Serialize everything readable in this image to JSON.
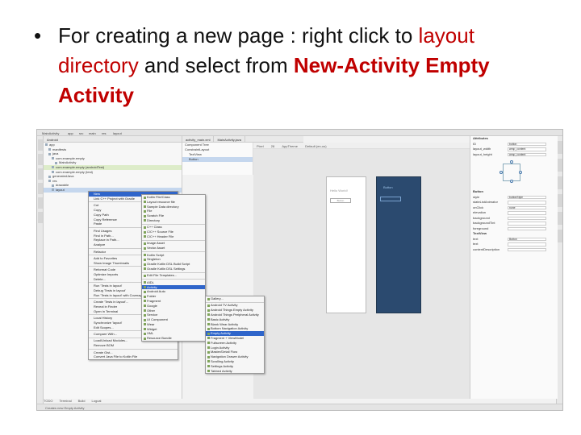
{
  "slide": {
    "bullet": "•",
    "line1_a": "For creating a new page : right click to ",
    "line1_b": "layout",
    "line2_a": "directory",
    "line2_b": " and select from ",
    "line2_c": "New-Activity Empty",
    "line3": "Activity"
  },
  "ide": {
    "titlebar": [
      "MainActivity",
      "app",
      "src",
      "main",
      "res",
      "layout"
    ],
    "project_header": "Android",
    "tree": [
      "app",
      "manifests",
      "java",
      "com.example.empty",
      "MainActivity",
      "com.example.empty (androidTest)",
      "com.example.empty (test)",
      "generatedJava",
      "res",
      "drawable",
      "layout"
    ],
    "editor_tabs": [
      "activity_main.xml",
      "MainActivity.java"
    ],
    "palette": [
      "Component Tree",
      "ConstraintLayout",
      "TextView",
      "Button"
    ],
    "design_toolbar": [
      "Pixel",
      "28",
      "AppTheme",
      "Default (en-us)"
    ],
    "phone_text": "Hello World!",
    "phone_button": "Button",
    "attributes": {
      "header": "Attributes",
      "rows": [
        {
          "k": "ID",
          "v": "button"
        },
        {
          "k": "layout_width",
          "v": "wrap_content"
        },
        {
          "k": "layout_height",
          "v": "wrap_content"
        }
      ],
      "section_button": "Button",
      "rows2": [
        {
          "k": "style",
          "v": "buttonStyle"
        },
        {
          "k": "stateListAnimator",
          "v": ""
        },
        {
          "k": "onClick",
          "v": "none"
        },
        {
          "k": "elevation",
          "v": ""
        },
        {
          "k": "background",
          "v": ""
        },
        {
          "k": "backgroundTint",
          "v": ""
        },
        {
          "k": "foreground",
          "v": ""
        }
      ],
      "section_textview": "TextView",
      "rows3": [
        {
          "k": "text",
          "v": "Button"
        },
        {
          "k": "text",
          "v": ""
        },
        {
          "k": "contentDescription",
          "v": ""
        }
      ]
    },
    "bottom_tabs": [
      "TODO",
      "Terminal",
      "Build",
      "Logcat"
    ],
    "status": "Creates new Empty Activity"
  },
  "menu1": [
    {
      "label": "New",
      "hl": true
    },
    {
      "label": "Link C++ Project with Gradle"
    },
    {
      "sep": true
    },
    {
      "label": "Cut",
      "sc": "Ctrl+X"
    },
    {
      "label": "Copy",
      "sc": "Ctrl+C"
    },
    {
      "label": "Copy Path",
      "sc": ""
    },
    {
      "label": "Copy Reference",
      "sc": ""
    },
    {
      "label": "Paste",
      "sc": "Ctrl+V"
    },
    {
      "sep": true
    },
    {
      "label": "Find Usages",
      "sc": "Alt+F7"
    },
    {
      "label": "Find in Path...",
      "sc": ""
    },
    {
      "label": "Replace in Path...",
      "sc": ""
    },
    {
      "label": "Analyze"
    },
    {
      "sep": true
    },
    {
      "label": "Refactor"
    },
    {
      "sep": true
    },
    {
      "label": "Add to Favorites"
    },
    {
      "label": "Show Image Thumbnails",
      "sc": ""
    },
    {
      "sep": true
    },
    {
      "label": "Reformat Code",
      "sc": ""
    },
    {
      "label": "Optimize Imports",
      "sc": ""
    },
    {
      "label": "Delete...",
      "sc": "Delete"
    },
    {
      "sep": true
    },
    {
      "label": "Run 'Tests in layout'"
    },
    {
      "label": "Debug 'Tests in layout'"
    },
    {
      "label": "Run 'Tests in layout' with Coverage"
    },
    {
      "sep": true
    },
    {
      "label": "Create 'Tests in layout'..."
    },
    {
      "label": "Reveal in Finder"
    },
    {
      "label": "Open in Terminal"
    },
    {
      "sep": true
    },
    {
      "label": "Local History"
    },
    {
      "label": "Synchronize 'layout'"
    },
    {
      "label": "Edit Scopes..."
    },
    {
      "sep": true
    },
    {
      "label": "Compare With...",
      "sc": ""
    },
    {
      "sep": true
    },
    {
      "label": "Load/Unload Modules..."
    },
    {
      "label": "Remove BOM"
    },
    {
      "sep": true
    },
    {
      "label": "Create Gist..."
    },
    {
      "label": "Convert Java File to Kotlin File"
    }
  ],
  "menu2": [
    {
      "label": "Kotlin File/Class"
    },
    {
      "label": "Layout resource file"
    },
    {
      "label": "Sample Data directory"
    },
    {
      "label": "File"
    },
    {
      "label": "Scratch File",
      "sc": ""
    },
    {
      "label": "Directory"
    },
    {
      "sep": true
    },
    {
      "label": "C++ Class"
    },
    {
      "label": "C/C++ Source File"
    },
    {
      "label": "C/C++ Header File"
    },
    {
      "sep": true
    },
    {
      "label": "Image Asset"
    },
    {
      "label": "Vector Asset"
    },
    {
      "sep": true
    },
    {
      "label": "Kotlin Script"
    },
    {
      "label": "Singleton"
    },
    {
      "label": "Gradle Kotlin DSL Build Script"
    },
    {
      "label": "Gradle Kotlin DSL Settings"
    },
    {
      "sep": true
    },
    {
      "label": "Edit File Templates..."
    },
    {
      "sep": true
    },
    {
      "label": "AIDL"
    },
    {
      "label": "Activity",
      "hl": true
    },
    {
      "label": "Android Auto"
    },
    {
      "label": "Folder"
    },
    {
      "label": "Fragment"
    },
    {
      "label": "Google"
    },
    {
      "label": "Other"
    },
    {
      "label": "Service"
    },
    {
      "label": "UI Component"
    },
    {
      "label": "Wear"
    },
    {
      "label": "Widget"
    },
    {
      "label": "XML"
    },
    {
      "label": "Resource Bundle"
    }
  ],
  "menu3": [
    {
      "label": "Gallery..."
    },
    {
      "sep": true
    },
    {
      "label": "Android TV Activity"
    },
    {
      "label": "Android Things Empty Activity"
    },
    {
      "label": "Android Things Peripheral Activity"
    },
    {
      "label": "Basic Activity"
    },
    {
      "label": "Blank Wear Activity"
    },
    {
      "label": "Bottom Navigation Activity"
    },
    {
      "label": "Empty Activity",
      "hl": true
    },
    {
      "label": "Fragment + ViewModel"
    },
    {
      "label": "Fullscreen Activity"
    },
    {
      "label": "Login Activity"
    },
    {
      "label": "Master/Detail Flow"
    },
    {
      "label": "Navigation Drawer Activity"
    },
    {
      "label": "Scrolling Activity"
    },
    {
      "label": "Settings Activity"
    },
    {
      "label": "Tabbed Activity"
    }
  ]
}
